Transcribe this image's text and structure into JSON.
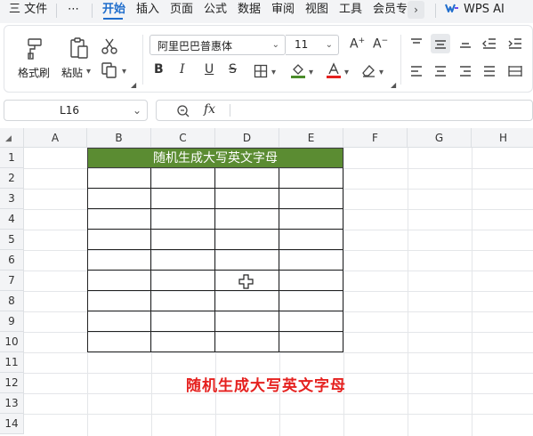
{
  "menubar": {
    "file_menu": "三 文件",
    "more_menu": "⋯",
    "tabs": [
      "开始",
      "插入",
      "页面",
      "公式",
      "数据",
      "审阅",
      "视图",
      "工具",
      "会员专"
    ],
    "more_tabs": "›",
    "ai": "WPS AI"
  },
  "ribbon": {
    "format_painter": "格式刷",
    "paste": "粘贴",
    "font_name": "阿里巴巴普惠体",
    "font_size": "11"
  },
  "formula_bar": {
    "name_box": "L16",
    "fx": "fx",
    "formula": ""
  },
  "sheet": {
    "columns": [
      "A",
      "B",
      "C",
      "D",
      "E",
      "F",
      "G",
      "H"
    ],
    "rows": [
      "1",
      "2",
      "3",
      "4",
      "5",
      "6",
      "7",
      "8",
      "9",
      "10",
      "11",
      "12",
      "13",
      "14"
    ],
    "table_title": "随机生成大写英文字母",
    "caption": "随机生成大写英文字母"
  },
  "colors": {
    "accent": "#1f6dcc",
    "header_fill": "#5b8c32",
    "caption": "#e5211f"
  }
}
